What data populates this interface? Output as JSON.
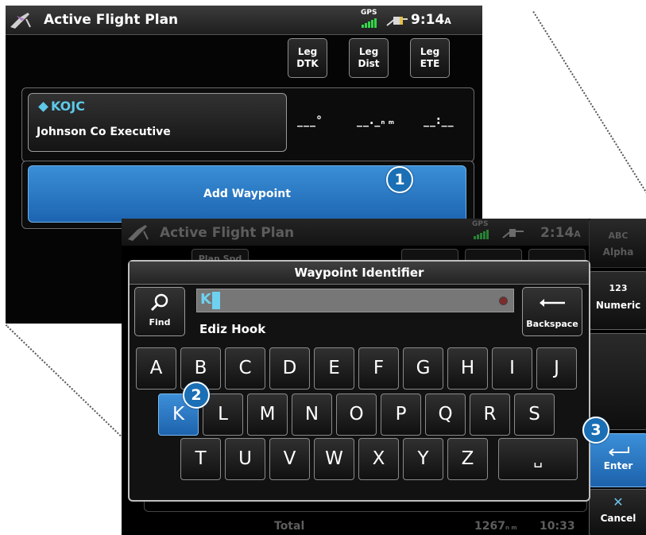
{
  "background_screen": {
    "title": "Active Flight Plan",
    "status": {
      "gps": "GPS",
      "time": "9:14",
      "time_suffix": "A"
    },
    "columns": [
      {
        "line1": "Leg",
        "line2": "DTK"
      },
      {
        "line1": "Leg",
        "line2": "Dist"
      },
      {
        "line1": "Leg",
        "line2": "ETE"
      }
    ],
    "waypoint": {
      "ident": "KOJC",
      "name": "Johnson Co Executive",
      "dtk": "___°",
      "dist": "__._",
      "dist_unit": "n m",
      "ete": "__:__"
    },
    "add_waypoint_label": "Add Waypoint",
    "callout": "1"
  },
  "foreground_screen": {
    "title": "Active Flight Plan",
    "status": {
      "gps": "GPS",
      "time": "2:14",
      "time_suffix": "A"
    },
    "ghost_button": "Plan Spd",
    "footer": {
      "label": "Total",
      "distance": "1267",
      "distance_unit": "n m",
      "ete": "10:33"
    },
    "side_buttons": {
      "alpha": "Alpha",
      "alpha_icon": "ABC",
      "numeric": "Numeric",
      "numeric_icon": "123",
      "enter": "Enter",
      "cancel": "Cancel"
    },
    "dialog": {
      "title": "Waypoint Identifier",
      "find_label": "Find",
      "input_value": "K",
      "suggestion": "Ediz Hook",
      "backspace_label": "Backspace"
    },
    "keyboard": {
      "row1": [
        "A",
        "B",
        "C",
        "D",
        "E",
        "F",
        "G",
        "H",
        "I",
        "J"
      ],
      "row2": [
        "K",
        "L",
        "M",
        "N",
        "O",
        "P",
        "Q",
        "R",
        "S"
      ],
      "row3": [
        "T",
        "U",
        "V",
        "W",
        "X",
        "Y",
        "Z"
      ],
      "space_label": "␣",
      "active_key": "K"
    },
    "callouts": [
      "2",
      "3"
    ]
  },
  "colors": {
    "accent_blue": "#1d64b1",
    "ident_cyan": "#5ec8e8",
    "gps_green": "#33d64a",
    "callout_blue": "#1a6fb5"
  }
}
